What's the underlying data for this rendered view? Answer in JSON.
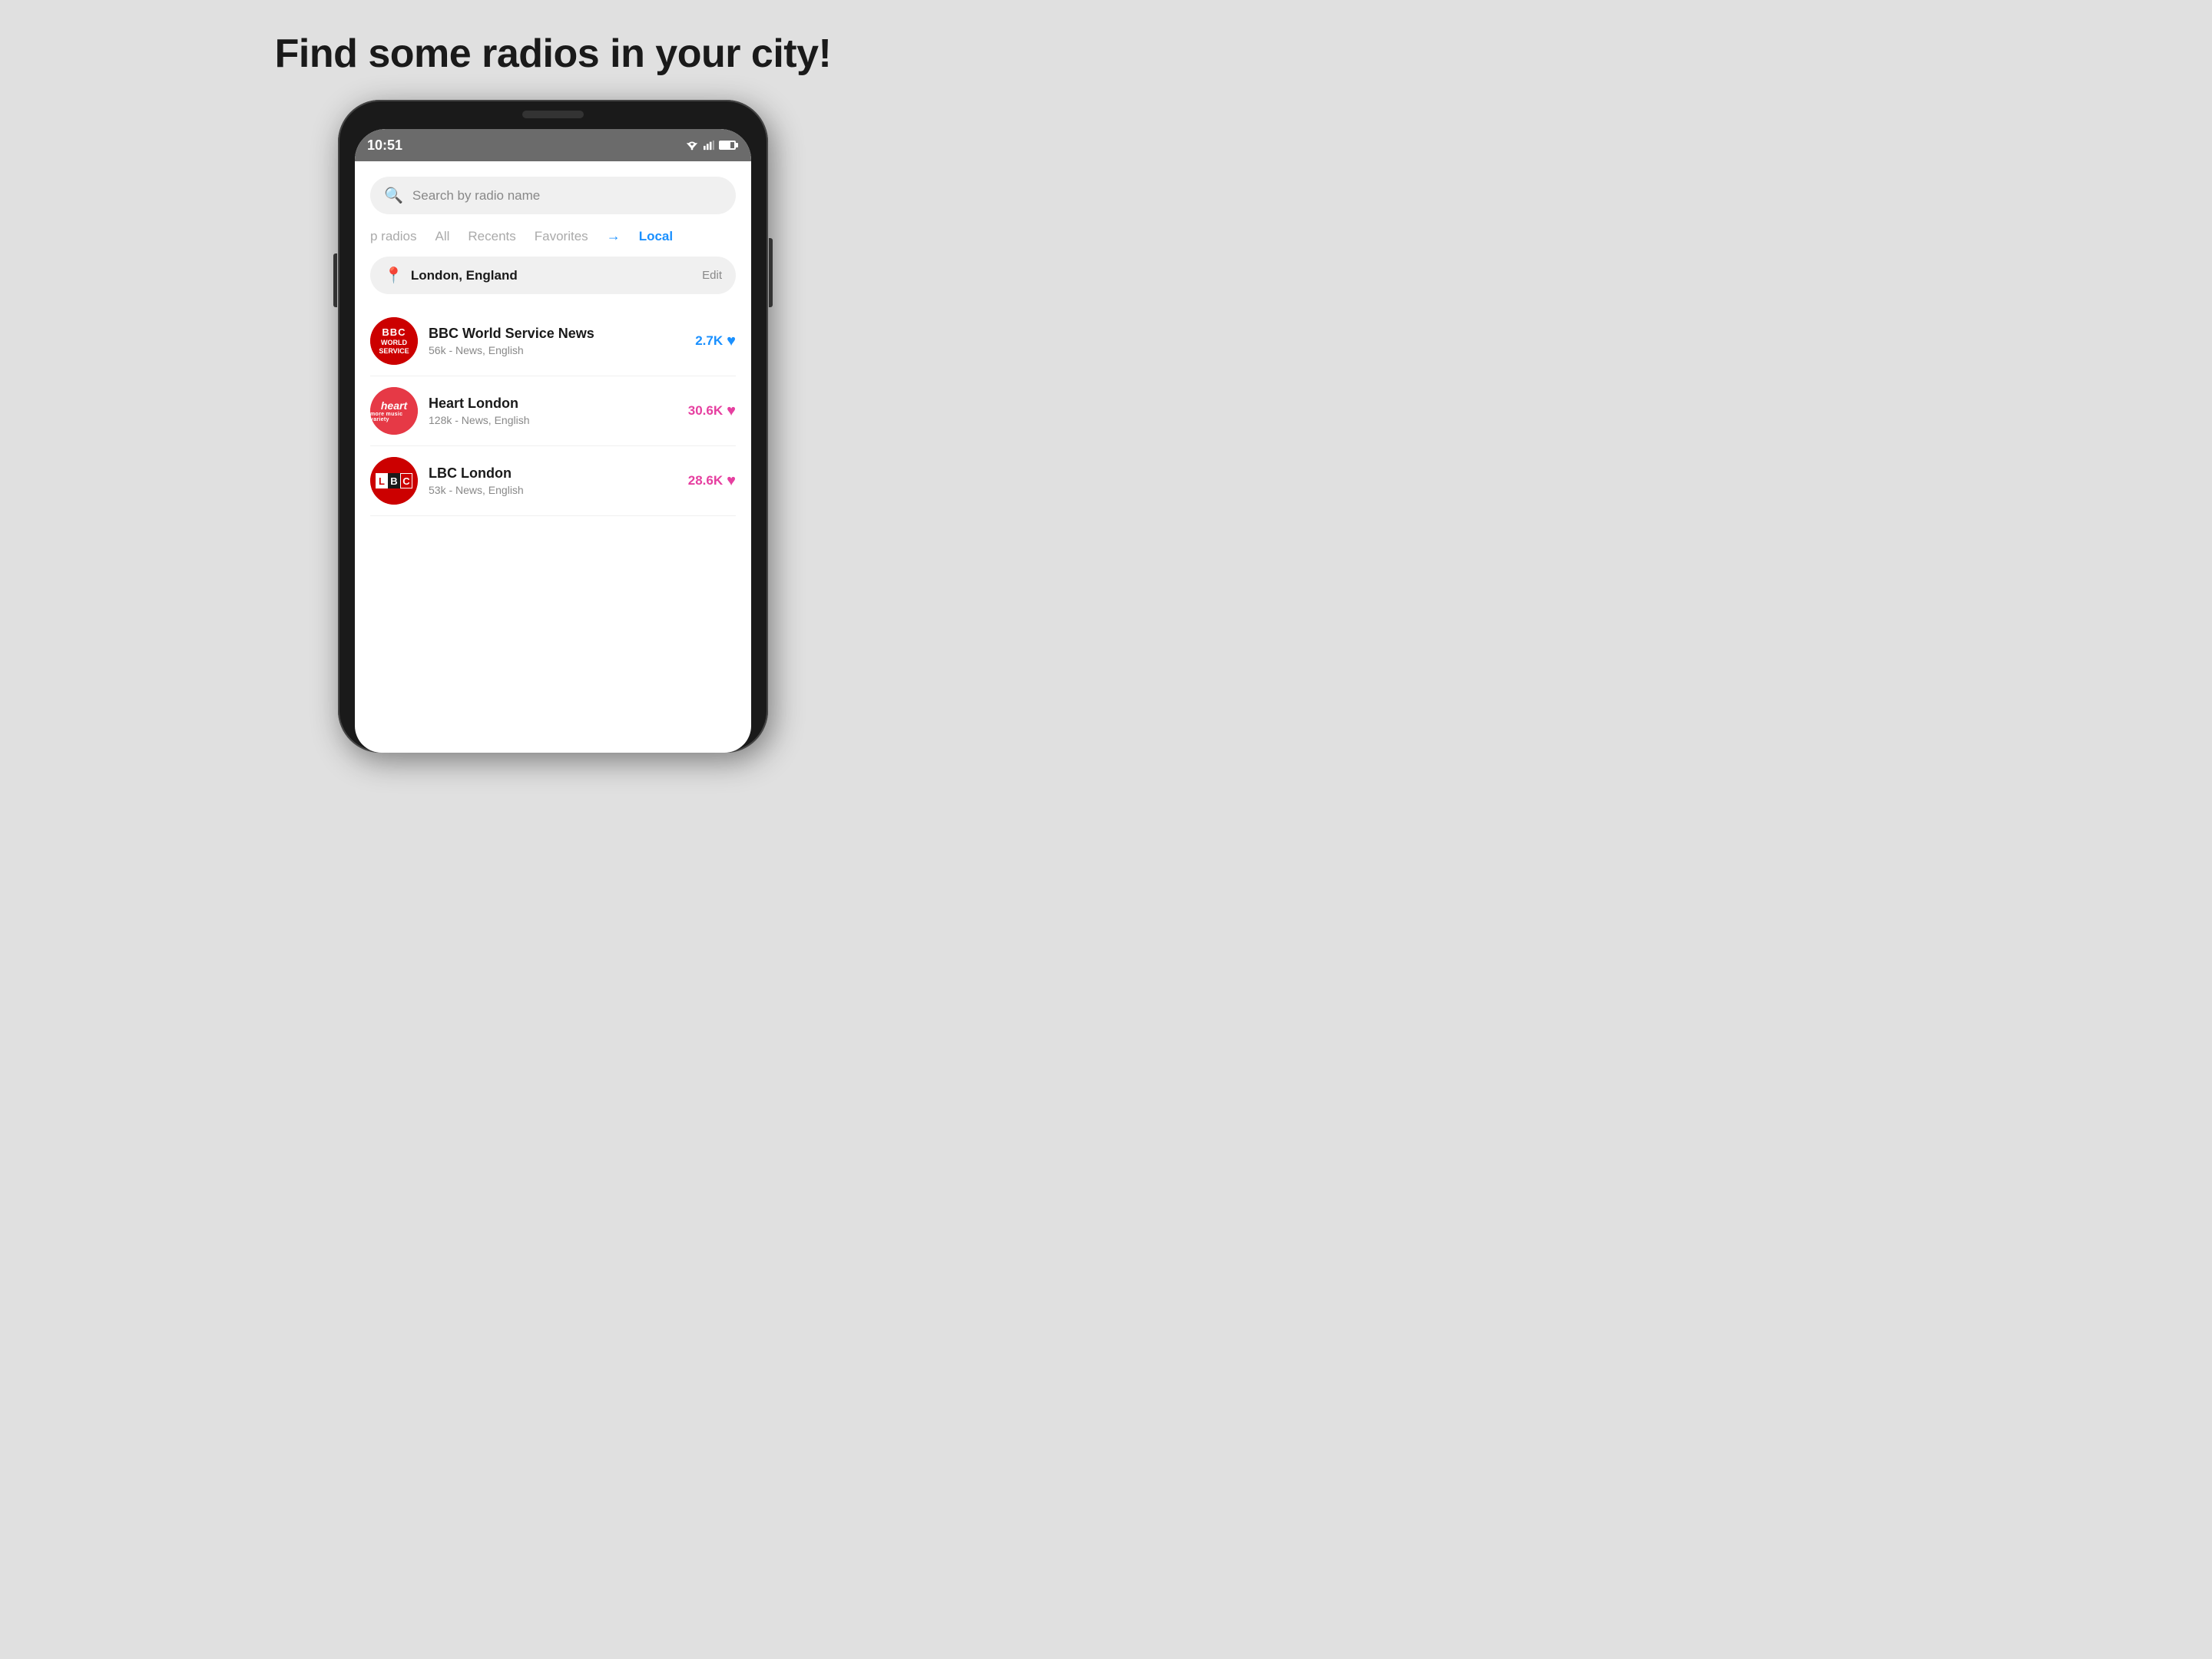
{
  "page": {
    "title": "Find some radios in your city!",
    "background": "#e0e0e0"
  },
  "status_bar": {
    "time": "10:51"
  },
  "search": {
    "placeholder": "Search by radio name"
  },
  "tabs": [
    {
      "label": "p radios",
      "active": false
    },
    {
      "label": "All",
      "active": false
    },
    {
      "label": "Recents",
      "active": false
    },
    {
      "label": "Favorites",
      "active": false
    },
    {
      "label": "→",
      "active": false
    },
    {
      "label": "Local",
      "active": true
    }
  ],
  "location": {
    "name": "London, England",
    "edit_label": "Edit"
  },
  "radios": [
    {
      "name": "BBC World Service News",
      "meta": "56k - News, English",
      "favorites": "2.7K",
      "color_type": "blue",
      "logo_type": "bbc"
    },
    {
      "name": "Heart London",
      "meta": "128k - News, English",
      "favorites": "30.6K",
      "color_type": "pink",
      "logo_type": "heart"
    },
    {
      "name": "LBC London",
      "meta": "53k - News, English",
      "favorites": "28.6K",
      "color_type": "pink",
      "logo_type": "lbc"
    }
  ]
}
